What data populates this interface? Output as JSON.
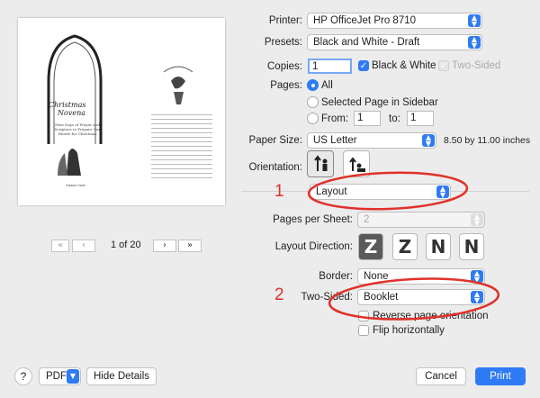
{
  "printer": {
    "label": "Printer:",
    "value": "HP OfficeJet Pro 8710"
  },
  "presets": {
    "label": "Presets:",
    "value": "Black and White - Draft"
  },
  "copies": {
    "label": "Copies:",
    "value": "1",
    "bw_label": "Black & White",
    "two_sided_label": "Two-Sided"
  },
  "pages": {
    "label": "Pages:",
    "all": "All",
    "selected": "Selected Page in Sidebar",
    "from": "From:",
    "from_value": "1",
    "to": "to:",
    "to_value": "1"
  },
  "paper": {
    "label": "Paper Size:",
    "value": "US Letter",
    "dims": "8.50 by 11.00 inches"
  },
  "orientation": {
    "label": "Orientation:"
  },
  "section": {
    "value": "Layout"
  },
  "pages_per_sheet": {
    "label": "Pages per Sheet:",
    "value": "2"
  },
  "layout_direction": {
    "label": "Layout Direction:",
    "options": [
      "Z",
      "Z",
      "N",
      "N"
    ]
  },
  "border": {
    "label": "Border:",
    "value": "None"
  },
  "two_sided": {
    "label": "Two-Sided:",
    "value": "Booklet"
  },
  "reverse_label": "Reverse page orientation",
  "flip_label": "Flip horizontally",
  "preview": {
    "page_indicator": "1 of 20",
    "title_line1": "Christmas",
    "title_line2": "Novena",
    "subtitle": "Nine Days of Prayer and Scripture to Prepare Our Hearts for Christmas",
    "author": "Santos Crane"
  },
  "annotations": {
    "one": "1",
    "two": "2"
  },
  "footer": {
    "help": "?",
    "pdf": "PDF",
    "hide_details": "Hide Details",
    "cancel": "Cancel",
    "print": "Print"
  },
  "colors": {
    "accent": "#2f7bf5",
    "annotation": "#e0312a"
  }
}
